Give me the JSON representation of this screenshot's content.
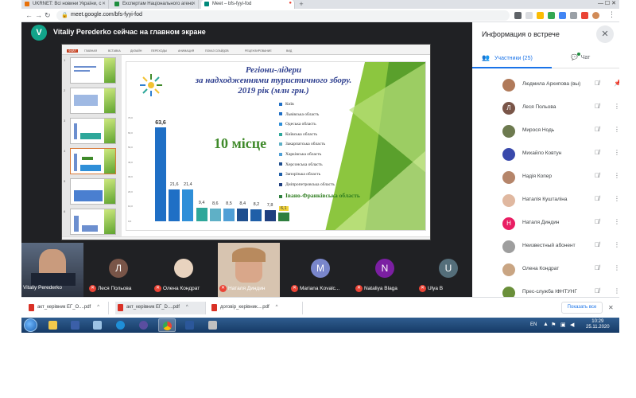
{
  "browser": {
    "tabs": [
      {
        "title": "UKRNET: Всі новини України, с"
      },
      {
        "title": "Експертам Національного агенс"
      },
      {
        "title": "Meet – bfs-fyyi-fod"
      }
    ],
    "url": "meet.google.com/bfs-fyyi-fod",
    "new_tab": "+",
    "win_controls": "—  ☐  ✕"
  },
  "meet": {
    "presenter_initial": "V",
    "presenting_text": "Vitaliy Perederko сейчас на главном экране"
  },
  "slide": {
    "title": "Регіони-лідери\nза надходженнями туристичного збору.\n2019 рік (млн грн.)",
    "rank_text": "10 місце"
  },
  "chart_data": {
    "type": "bar",
    "title": "Регіони-лідери за надходженнями туристичного збору. 2019 рік (млн грн.)",
    "categories": [
      "Київ",
      "Львівська область",
      "Одеська область",
      "Київська область",
      "Закарпатська область",
      "Харківська область",
      "Херсонська область",
      "Запорізька область",
      "Дніпропетровська область",
      "Івано-Франківська область"
    ],
    "values": [
      63.6,
      21.6,
      21.4,
      9.4,
      8.6,
      8.5,
      8.4,
      8.2,
      7.8,
      6.1
    ],
    "value_labels": [
      "63,6",
      "21,6",
      "21,4",
      "9,4",
      "8,6",
      "8,5",
      "8,4",
      "8,2",
      "7,8",
      "6,1"
    ],
    "colors": [
      "#1f6fc5",
      "#1f6fc5",
      "#2f8fd8",
      "#2ea79a",
      "#5fb0c6",
      "#4f9fd6",
      "#1f4f8f",
      "#1f5fa8",
      "#1f3f7f",
      "#2f7f3f"
    ],
    "highlight_index": 9,
    "ylim": [
      0,
      70
    ]
  },
  "participants_strip": [
    {
      "name": "Vitaliy Perederko",
      "initial": "",
      "color": "#4a5a70",
      "muted": false
    },
    {
      "name": "Леся Польова",
      "initial": "Л",
      "color": "#795548",
      "muted": true
    },
    {
      "name": "Олена Кондрат",
      "initial": "",
      "color": "#c9a583",
      "muted": true
    },
    {
      "name": "Наталя Диндин",
      "initial": "",
      "color": "#d9b08c",
      "muted": true
    },
    {
      "name": "Mariana Kovalc...",
      "initial": "M",
      "color": "#7986cb",
      "muted": true
    },
    {
      "name": "Nataliya Blaga",
      "initial": "N",
      "color": "#7b1fa2",
      "muted": true
    },
    {
      "name": "Ulya B",
      "initial": "U",
      "color": "#546e7a",
      "muted": true
    }
  ],
  "panel": {
    "title": "Информация о встрече",
    "close": "✕",
    "tab_people": "Участники (25)",
    "tab_chat": "Чат",
    "participants": [
      {
        "name": "Людмила Архипова (вы)",
        "initial": "",
        "color": "#b07a5a",
        "action": "pin"
      },
      {
        "name": "Леся Польова",
        "initial": "Л",
        "color": "#795548",
        "action": "more"
      },
      {
        "name": "Мирося Нодь",
        "initial": "",
        "color": "#6d7a4f",
        "action": "more"
      },
      {
        "name": "Михайло Ковтун",
        "initial": "",
        "color": "#3949ab",
        "action": "more"
      },
      {
        "name": "Надія Копер",
        "initial": "",
        "color": "#b5856a",
        "action": "more"
      },
      {
        "name": "Наталія Кушталіна",
        "initial": "",
        "color": "#e0b8a0",
        "action": "more"
      },
      {
        "name": "Наталя Диндин",
        "initial": "Н",
        "color": "#e91e63",
        "action": "more"
      },
      {
        "name": "Неизвестный абонент",
        "initial": "",
        "color": "#9e9e9e",
        "action": "more"
      },
      {
        "name": "Олена Кондрат",
        "initial": "",
        "color": "#c9a583",
        "action": "more"
      },
      {
        "name": "Прес-служба ІФНТУНГ",
        "initial": "",
        "color": "#6a8f3a",
        "action": "more"
      }
    ]
  },
  "downloads": {
    "items": [
      {
        "name": "акт_керівник ЕГ_О....pdf"
      },
      {
        "name": "акт_керівник ЕГ_D....pdf"
      },
      {
        "name": "договір_керівник....pdf"
      }
    ],
    "show_all": "Показать все",
    "close": "✕"
  },
  "taskbar": {
    "lang": "EN",
    "time": "10:29",
    "date": "25.11.2020"
  }
}
